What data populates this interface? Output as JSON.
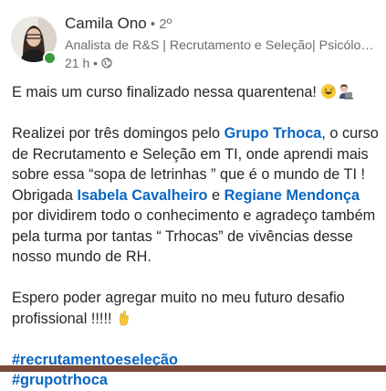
{
  "author": {
    "name": "Camila Ono",
    "connection": " • 2º",
    "headline": "Analista de R&S | Recrutamento e Seleção| Psicóloga...",
    "time": "21 h •"
  },
  "post": {
    "line1": "E mais um curso finalizado nessa quarentena! ",
    "p2_a": "Realizei por três domingos pelo ",
    "p2_link1": "Grupo Trhoca",
    "p2_b": ", o curso de Recrutamento e Seleção em TI, onde aprendi mais sobre essa “sopa de letrinhas ” que é o mundo de TI ! Obrigada ",
    "p2_link2": "Isabela Cavalheiro",
    "p2_c": " e ",
    "p2_link3": "Regiane Mendonça",
    "p2_d": " por dividirem todo o conhecimento e agradeço também pela turma por tantas “ Trhocas” de vivências desse nosso mundo de RH.",
    "p3": "Espero poder agregar muito no meu futuro desafio profissional !!!!! ",
    "hashtags": [
      "#recrutamentoeseleção",
      "#grupotrhoca"
    ]
  },
  "icons": {
    "globe": "globe-icon",
    "online_status": "online-status-dot",
    "emoji_1": "grinning-sweat-emoji",
    "emoji_2": "technologist-emoji",
    "emoji_3": "crossed-fingers-emoji"
  },
  "colors": {
    "link": "#0a66c2",
    "text": "#262626",
    "muted": "#6b6b6b",
    "online": "#3a9b3c"
  }
}
